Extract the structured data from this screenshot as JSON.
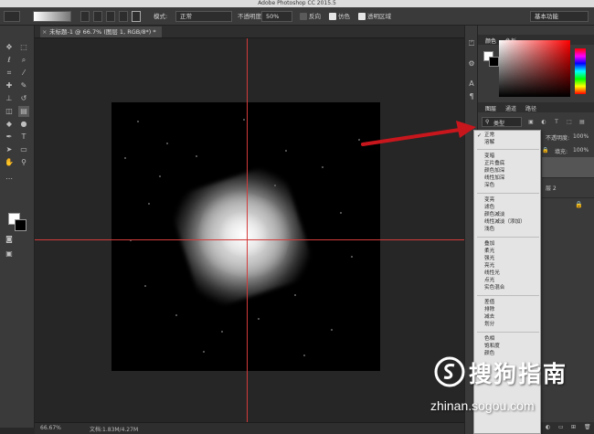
{
  "app": {
    "title": "Adobe Photoshop CC 2015.5"
  },
  "options_bar": {
    "mode_label": "模式:",
    "mode_value": "正常",
    "opacity_label": "不透明度:",
    "opacity_value": "50%",
    "reverse_label": "反向",
    "dither_label": "仿色",
    "transparency_label": "透明区域",
    "workspace_value": "基本功能"
  },
  "document": {
    "tab_label": "未标题-1 @ 66.7% (图层 1, RGB/8*) *",
    "zoom": "66.67%",
    "doc_info": "文档:1.83M/4.27M"
  },
  "color_panel": {
    "tab1": "颜色",
    "tab2": "色板"
  },
  "layers_panel": {
    "tab1": "图层",
    "tab2": "通道",
    "tab3": "路径",
    "filter_kind": "类型",
    "opacity_label": "不透明度:",
    "opacity_value": "100%",
    "fill_label": "填充:",
    "fill_value": "100%",
    "layer_fragment": "层 2"
  },
  "blend_menu": {
    "selected": "正常",
    "groups": [
      [
        "正常",
        "溶解"
      ],
      [
        "变暗",
        "正片叠底",
        "颜色加深",
        "线性加深",
        "深色"
      ],
      [
        "变亮",
        "滤色",
        "颜色减淡",
        "线性减淡（添加）",
        "浅色"
      ],
      [
        "叠加",
        "柔光",
        "强光",
        "亮光",
        "线性光",
        "点光",
        "实色混合"
      ],
      [
        "差值",
        "排除",
        "减去",
        "划分"
      ],
      [
        "色相",
        "饱和度",
        "颜色"
      ]
    ]
  },
  "watermark": {
    "brand": "搜狗指南",
    "url": "zhinan.sogou.com"
  },
  "colors": {
    "accent_guides": "#d43a3a",
    "arrow": "#c8161d"
  }
}
